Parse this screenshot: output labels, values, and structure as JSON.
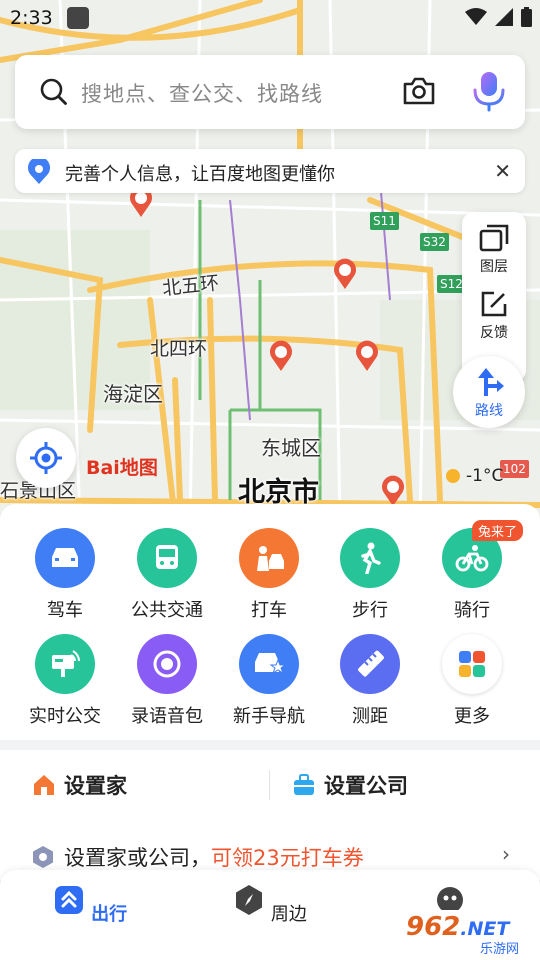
{
  "status_bar": {
    "time": "2:33"
  },
  "search": {
    "placeholder": "搜地点、查公交、找路线"
  },
  "notice": {
    "text": "完善个人信息，让百度地图更懂你",
    "close": "✕"
  },
  "map": {
    "labels": {
      "ring5": "北五环",
      "ring4": "北四环",
      "haidian": "海淀区",
      "dongcheng": "东城区",
      "city": "北京市",
      "shijingshan": "石景山区"
    },
    "shields": [
      "S11",
      "S32",
      "S12",
      "102"
    ],
    "logo": "Bai地图",
    "weather": "-1°C"
  },
  "side_tools": {
    "layers": "图层",
    "feedback": "反馈",
    "route": "路线"
  },
  "features": {
    "row1": [
      {
        "label": "驾车",
        "icon": "car-icon",
        "color": "#3f7ef5"
      },
      {
        "label": "公共交通",
        "icon": "bus-icon",
        "color": "#27c49a"
      },
      {
        "label": "打车",
        "icon": "taxi-icon",
        "color": "#f47734"
      },
      {
        "label": "步行",
        "icon": "walk-icon",
        "color": "#27c49a"
      },
      {
        "label": "骑行",
        "icon": "bike-icon",
        "color": "#27c49a"
      }
    ],
    "row2": [
      {
        "label": "实时公交",
        "icon": "realtime-bus-icon",
        "color": "#27c49a"
      },
      {
        "label": "录语音包",
        "icon": "voice-pack-icon",
        "color": "#8a5cf6"
      },
      {
        "label": "新手导航",
        "icon": "novice-nav-icon",
        "color": "#3f7ef5"
      },
      {
        "label": "测距",
        "icon": "ruler-icon",
        "color": "#5b6df0"
      },
      {
        "label": "更多",
        "icon": "more-grid-icon",
        "color": "#ffffff"
      }
    ],
    "badge": "兔来了"
  },
  "setup": {
    "home": "设置家",
    "company": "设置公司",
    "promo_prefix": "设置家或公司，",
    "promo_highlight": "可领23元打车券",
    "arrow": "›"
  },
  "bottom_nav": {
    "tabs": [
      {
        "label": "出行",
        "active": true
      },
      {
        "label": "周边",
        "active": false
      }
    ]
  },
  "watermark": {
    "main": "962",
    "net": ".NET",
    "sub": "乐游网"
  },
  "colors": {
    "accent": "#2d6cf3",
    "promo": "#f0552f",
    "road_major": "#f7c661",
    "green_route": "#31a05a"
  }
}
